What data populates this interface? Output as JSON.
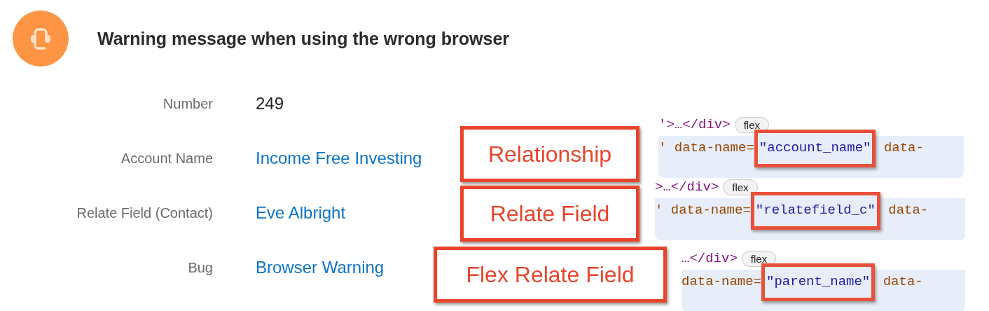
{
  "record": {
    "title": "Warning message when using the wrong browser"
  },
  "fields": [
    {
      "label": "Number",
      "value": "249",
      "kind": "text"
    },
    {
      "label": "Account Name",
      "value": "Income Free Investing",
      "kind": "link"
    },
    {
      "label": "Relate Field (Contact)",
      "value": "Eve Albright",
      "kind": "link"
    },
    {
      "label": "Bug",
      "value": "Browser Warning",
      "kind": "link"
    }
  ],
  "callouts": [
    {
      "text": "Relationship"
    },
    {
      "text": "Relate Field"
    },
    {
      "text": "Flex Relate Field"
    }
  ],
  "snippets": [
    {
      "tag_line": "'>…</div>",
      "pill": "flex",
      "prefix": "' data-name=",
      "attr_value": "\"account_name\"",
      "suffix": "data-"
    },
    {
      "tag_line": ">…</div>",
      "pill": "flex",
      "prefix": "' data-name=",
      "attr_value": "\"relatefield_c\"",
      "suffix": "data-"
    },
    {
      "tag_line": "…</div>",
      "pill": "flex",
      "prefix": "data-name=",
      "attr_value": "\"parent_name\"",
      "suffix": "data-"
    }
  ]
}
